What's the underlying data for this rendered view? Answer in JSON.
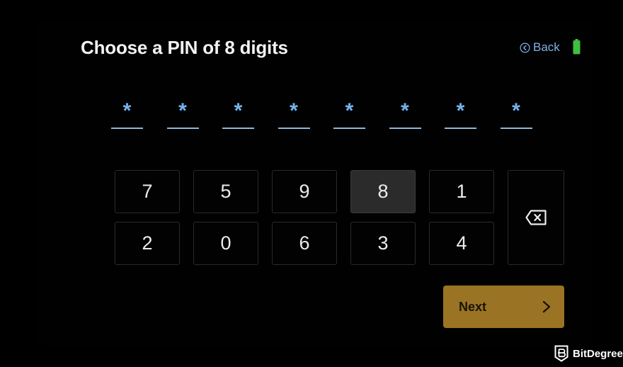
{
  "header": {
    "title": "Choose a PIN of 8 digits",
    "back_label": "Back",
    "back_icon": "circle-chevron-left-icon",
    "battery_icon": "battery-full-icon",
    "battery_color": "#3fbf3f"
  },
  "pin": {
    "length": 8,
    "entered": 8,
    "mask_char": "*",
    "slots": [
      "*",
      "*",
      "*",
      "*",
      "*",
      "*",
      "*",
      "*"
    ],
    "accent_color": "#74b4ef"
  },
  "keypad": {
    "keys": [
      {
        "label": "7",
        "pressed": false
      },
      {
        "label": "5",
        "pressed": false
      },
      {
        "label": "9",
        "pressed": false
      },
      {
        "label": "8",
        "pressed": true
      },
      {
        "label": "1",
        "pressed": false
      },
      {
        "label": "2",
        "pressed": false
      },
      {
        "label": "0",
        "pressed": false
      },
      {
        "label": "6",
        "pressed": false
      },
      {
        "label": "3",
        "pressed": false
      },
      {
        "label": "4",
        "pressed": false
      }
    ],
    "backspace_icon": "backspace-icon"
  },
  "actions": {
    "next_label": "Next",
    "next_icon": "chevron-right-icon",
    "next_color": "#9a7424"
  },
  "watermark": {
    "label": "BitDegree",
    "icon": "bitdegree-shield-icon"
  }
}
